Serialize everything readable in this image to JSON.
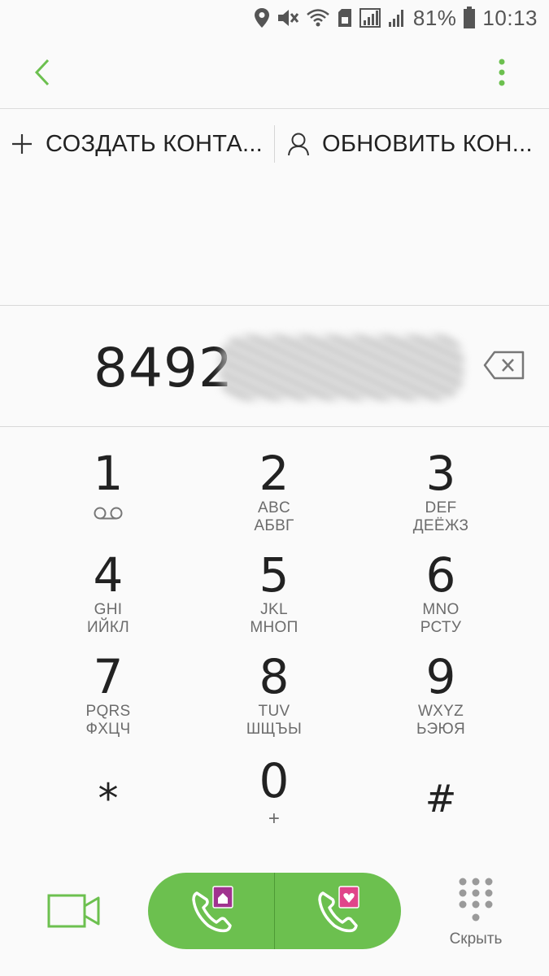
{
  "status_bar": {
    "battery_percent": "81%",
    "time": "10:13",
    "icons": [
      "location-icon",
      "mute-icon",
      "wifi-icon",
      "sim-icon",
      "signal-icon",
      "signal-icon",
      "battery-icon"
    ]
  },
  "toolbar": {
    "back_icon": "back-arrow-icon",
    "more_icon": "more-vert-icon"
  },
  "actions": {
    "create_label": "СОЗДАТЬ КОНТА...",
    "update_label": "ОБНОВИТЬ КОН..."
  },
  "number_display": {
    "visible_prefix": "8492"
  },
  "keypad": {
    "keys": [
      {
        "digit": "1",
        "sub1": "",
        "sub2": "",
        "icon": "voicemail-icon"
      },
      {
        "digit": "2",
        "sub1": "ABC",
        "sub2": "АБВГ"
      },
      {
        "digit": "3",
        "sub1": "DEF",
        "sub2": "ДЕЁЖЗ"
      },
      {
        "digit": "4",
        "sub1": "GHI",
        "sub2": "ИЙКЛ"
      },
      {
        "digit": "5",
        "sub1": "JKL",
        "sub2": "МНОП"
      },
      {
        "digit": "6",
        "sub1": "MNO",
        "sub2": "РСТУ"
      },
      {
        "digit": "7",
        "sub1": "PQRS",
        "sub2": "ФХЦЧ"
      },
      {
        "digit": "8",
        "sub1": "TUV",
        "sub2": "ШЩЪЫ"
      },
      {
        "digit": "9",
        "sub1": "WXYZ",
        "sub2": "ЬЭЮЯ"
      },
      {
        "digit": "*",
        "sub1": "",
        "sub2": ""
      },
      {
        "digit": "0",
        "sub1": "+",
        "sub2": ""
      },
      {
        "digit": "#",
        "sub1": "",
        "sub2": ""
      }
    ]
  },
  "bottom": {
    "hide_label": "Скрыть"
  },
  "colors": {
    "accent_green": "#6cc04f",
    "sim1_badge": "#a0338f",
    "sim2_badge": "#e0448a"
  }
}
